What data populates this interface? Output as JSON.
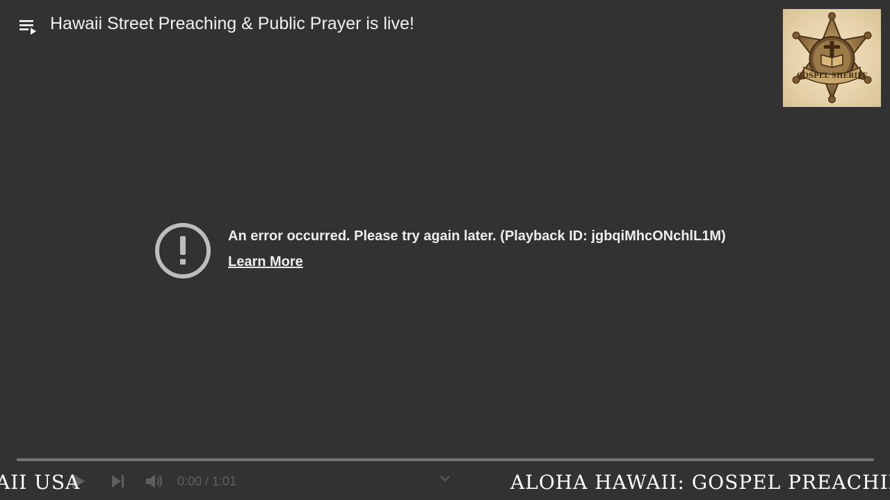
{
  "header": {
    "title": "Hawaii Street Preaching & Public Prayer is live!",
    "playlist_icon": "playlist-icon"
  },
  "channel_logo": {
    "badge_text": "GOSPEL SHERIFF",
    "icon": "sheriff-star-badge"
  },
  "error": {
    "icon": "exclamation-circle-icon",
    "message": "An error occurred. Please try again later. (Playback ID: jgbqiMhcONchlL1M)",
    "learn_more": "Learn More"
  },
  "player": {
    "progress": 0.0,
    "time": "0:00 / 1:01",
    "controls": [
      "play-icon",
      "next-icon",
      "volume-icon",
      "chevron-down-icon"
    ]
  },
  "ticker": {
    "left_text": "AII USA",
    "right_text": "ALOHA HAWAII: GOSPEL PREACHING FR"
  },
  "colors": {
    "background": "#323232",
    "text": "#ffffff",
    "progress_track": "#8c8c8c",
    "badge_gold": "#b8925a"
  }
}
